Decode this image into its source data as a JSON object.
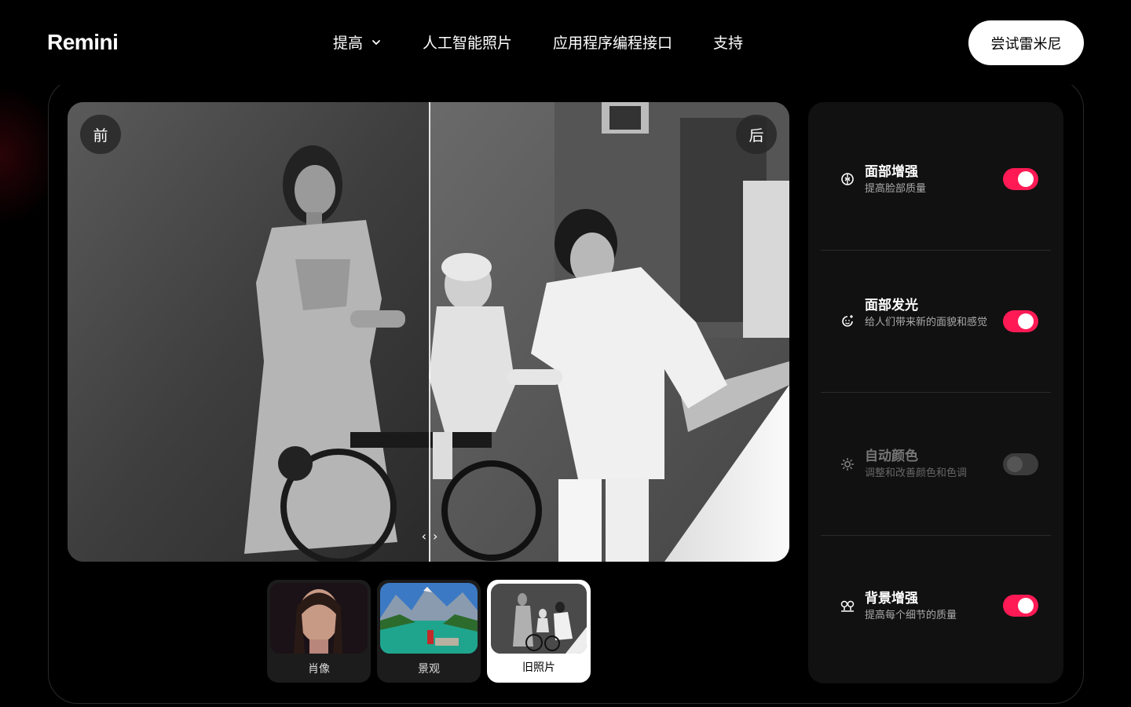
{
  "nav": {
    "logo": "Remini",
    "links": [
      {
        "label": "提高"
      },
      {
        "label": "人工智能照片"
      },
      {
        "label": "应用程序编程接口"
      },
      {
        "label": "支持"
      }
    ],
    "cta": "尝试雷米尼"
  },
  "viewer": {
    "before_label": "前",
    "after_label": "后",
    "divider_position_pct": 50
  },
  "thumbnails": [
    {
      "label": "肖像",
      "active": false
    },
    {
      "label": "景观",
      "active": false
    },
    {
      "label": "旧照片",
      "active": true
    }
  ],
  "options": [
    {
      "title": "面部增强",
      "desc": "提高脸部质量",
      "on": true,
      "icon": "face-enhance-icon"
    },
    {
      "title": "面部发光",
      "desc": "给人们带来新的面貌和感觉",
      "on": true,
      "icon": "face-glow-icon"
    },
    {
      "title": "自动颜色",
      "desc": "调整和改善颜色和色调",
      "on": false,
      "icon": "sun-icon"
    },
    {
      "title": "背景增强",
      "desc": "提高每个细节的质量",
      "on": true,
      "icon": "trees-icon"
    }
  ],
  "colors": {
    "accent": "#ff1a55",
    "panel": "#111111",
    "background": "#000000"
  }
}
